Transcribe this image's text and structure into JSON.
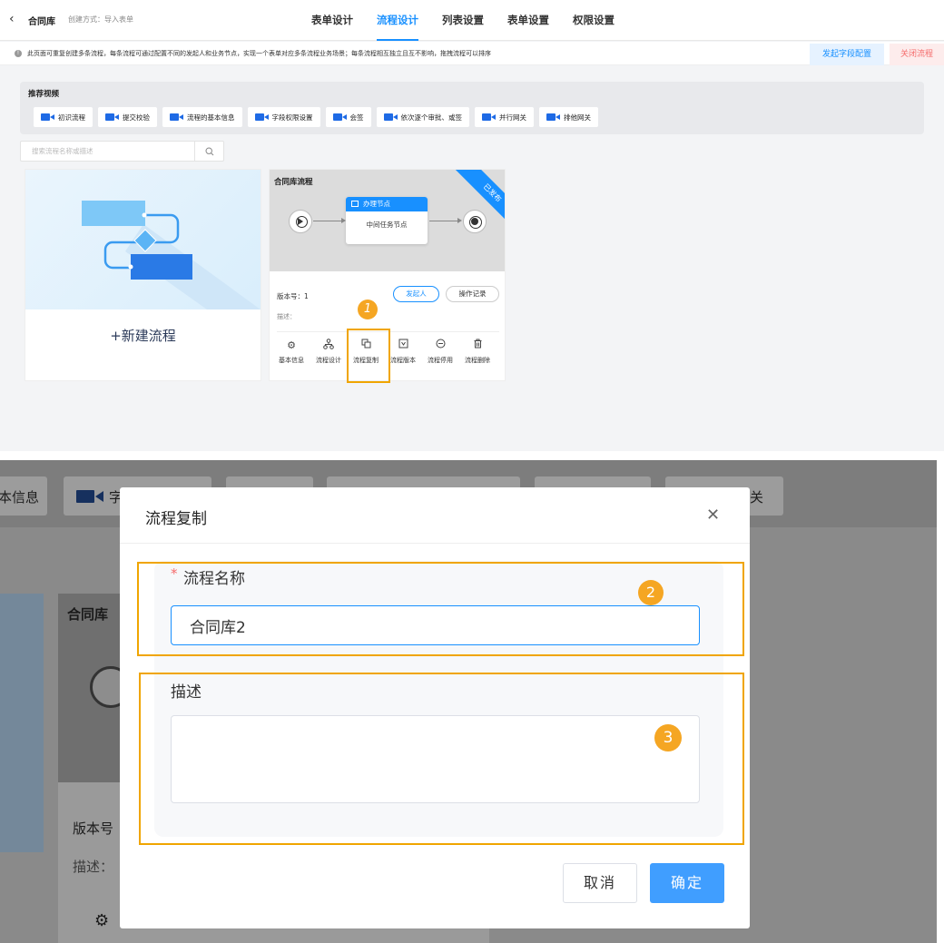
{
  "header": {
    "back_icon": "chevron-left-icon",
    "app_name": "合同库",
    "created_text": "创建方式：导入表单",
    "tabs": [
      {
        "label": "表单设计"
      },
      {
        "label": "流程设计"
      },
      {
        "label": "列表设置"
      },
      {
        "label": "表单设置"
      },
      {
        "label": "权限设置"
      }
    ],
    "active_tab": "流程设计"
  },
  "tipbar": {
    "text": "此页面可重复创建多条流程，每条流程可通过配置不同的发起人和业务节点，实现一个表单对应多条流程业务场景；每条流程相互独立且互不影响，拖拽流程可以排序",
    "field_config_label": "发起字段配置",
    "close_flow_label": "关闭流程"
  },
  "videos": {
    "title": "推荐视频",
    "items": [
      "初识流程",
      "提交校验",
      "流程的基本信息",
      "字段权限设置",
      "会签",
      "依次逐个审批、或签",
      "并行网关",
      "排他网关"
    ]
  },
  "search": {
    "placeholder": "搜索流程名称或描述"
  },
  "new_flow": {
    "label": "+新建流程"
  },
  "flow_card": {
    "title": "合同库流程",
    "ribbon": "已发布",
    "node_title": "办理节点",
    "node_body": "中间任务节点",
    "version": "版本号：1",
    "description": "描述：",
    "starter_label": "发起人",
    "log_label": "操作记录",
    "actions": [
      {
        "label": "基本信息",
        "icon": "gear-icon"
      },
      {
        "label": "流程设计",
        "icon": "flowchart-icon"
      },
      {
        "label": "流程复制",
        "icon": "copy-icon"
      },
      {
        "label": "流程版本",
        "icon": "version-icon"
      },
      {
        "label": "流程停用",
        "icon": "disable-icon"
      },
      {
        "label": "流程删除",
        "icon": "trash-icon"
      }
    ]
  },
  "annotations": {
    "badge1": "1",
    "badge2": "2",
    "badge3": "3"
  },
  "background": {
    "chip_left_text": "本信息",
    "chip_field_text": "字",
    "chip_right_text": "关",
    "card_title": "合同库",
    "version": "版本号",
    "description": "描述："
  },
  "modal": {
    "title": "流程复制",
    "close_icon": "close-icon",
    "required_mark": "*",
    "name_label": "流程名称",
    "name_value": "合同库2",
    "desc_label": "描述",
    "desc_value": "",
    "cancel_label": "取消",
    "ok_label": "确定"
  },
  "colors": {
    "accent": "#1890ff",
    "annotation": "#f0a500",
    "danger": "#f56c6c"
  }
}
